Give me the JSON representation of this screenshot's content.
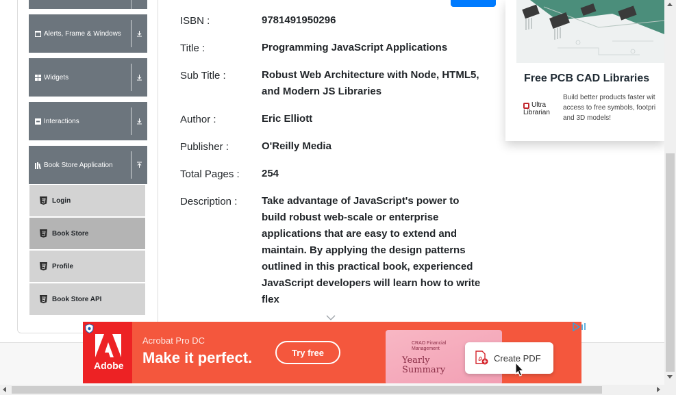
{
  "sidebar": {
    "groups": [
      {
        "label": "Alerts, Frame & Windows",
        "icon": "window-icon"
      },
      {
        "label": "Widgets",
        "icon": "grid-icon"
      },
      {
        "label": "Interactions",
        "icon": "list-icon"
      },
      {
        "label": "Book Store Application",
        "icon": "books-icon"
      }
    ],
    "items": [
      {
        "label": "Login"
      },
      {
        "label": "Book Store",
        "active": true
      },
      {
        "label": "Profile"
      },
      {
        "label": "Book Store API"
      }
    ]
  },
  "book": {
    "isbn_label": "ISBN :",
    "isbn": "9781491950296",
    "title_label": "Title :",
    "title": "Programming JavaScript Applications",
    "subtitle_label": "Sub Title :",
    "subtitle_line1": "Robust Web Architecture with Node, HTML5,",
    "subtitle_line2": "and Modern JS Libraries",
    "author_label": "Author :",
    "author": "Eric Elliott",
    "publisher_label": "Publisher :",
    "publisher": "O'Reilly Media",
    "pages_label": "Total Pages :",
    "pages": "254",
    "description_label": "Description :",
    "description_lines": [
      "Take advantage of JavaScript's power to",
      "build robust web-scale or enterprise",
      "applications that are easy to extend and",
      "maintain. By applying the design patterns",
      "outlined in this practical book, experienced",
      "JavaScript developers will learn how to write",
      "flex"
    ]
  },
  "side_ad": {
    "title": "Free PCB CAD Libraries",
    "text_lines": [
      "Build better products faster wit",
      "access to free symbols, footpri",
      "and 3D models!"
    ],
    "logo_line1": "Ultra",
    "logo_line2": "Librarian"
  },
  "bottom_ad": {
    "brand": "Adobe",
    "product": "Acrobat Pro DC",
    "tagline": "Make it perfect.",
    "cta": "Try free",
    "doc_small": "CRAO Financial Management",
    "doc_title_line1": "Yearly",
    "doc_title_line2": "Summary",
    "pdf_button": "Create PDF"
  },
  "colors": {
    "sidebar_group": "#6c757d",
    "sidebar_item": "#d3d3d3",
    "sidebar_item_active": "#b4b4b4",
    "ad_red": "#f4573d",
    "adobe_red": "#ed2224",
    "primary_blue": "#007bff"
  }
}
